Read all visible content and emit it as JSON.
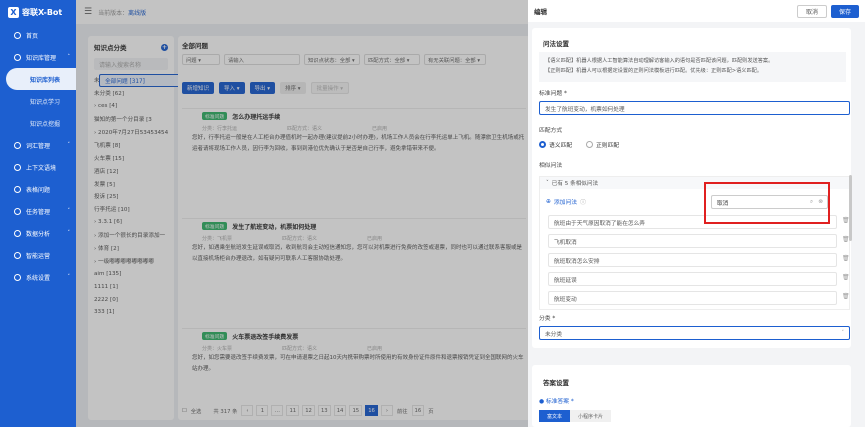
{
  "app": {
    "title": "容联X-Bot",
    "logo_letter": "X"
  },
  "topbar": {
    "version_label": "当前版本：",
    "version_value": "离线版"
  },
  "sidebar": {
    "items": [
      {
        "label": "首页",
        "icon": "home-icon",
        "chev": ""
      },
      {
        "label": "知识库管理",
        "icon": "book-icon",
        "chev": "˄"
      },
      {
        "label": "知识库列表",
        "sub": true,
        "active": true
      },
      {
        "label": "知识点学习",
        "sub": true
      },
      {
        "label": "知识点挖掘",
        "sub": true
      },
      {
        "label": "词汇管理",
        "icon": "vocab-icon",
        "chev": "˅"
      },
      {
        "label": "上下文语境",
        "icon": "context-icon",
        "chev": ""
      },
      {
        "label": "表格问题",
        "icon": "table-icon",
        "chev": ""
      },
      {
        "label": "任务管理",
        "icon": "task-icon",
        "chev": "˅"
      },
      {
        "label": "数据分析",
        "icon": "chart-icon",
        "chev": "˅"
      },
      {
        "label": "智能运营",
        "icon": "ops-icon",
        "chev": ""
      },
      {
        "label": "系统设置",
        "icon": "gear-icon",
        "chev": "˅"
      }
    ]
  },
  "kcat": {
    "title": "知识点分类",
    "search_placeholder": "请输入搜索名称",
    "tree": [
      "全部问题 [317]",
      "未审核 [24]",
      "未分类 [62]",
      "› ces [4]",
      "  猫知的第一个分目录 [3",
      "› 2020年7月27日534534543",
      "  飞机票 [8]",
      "  火车票 [15]",
      "  酒店 [12]",
      "  发票 [5]",
      "  投诉 [25]",
      "  行李托运 [10]",
      "› 3.3.1 [6]",
      "› 添加一个很长的目录添加一",
      "› 体育 [2]",
      "› 一级嘟嘟嘟嘟嘟嘟嘟嘟",
      "  aim [135]",
      "  1111 [1]",
      "  2222 [0]",
      "  333 [1]"
    ]
  },
  "main": {
    "title": "全部问题",
    "filters": [
      "问题  ▾",
      "请输入",
      "知识点状态：全部 ▾",
      "匹配方式：全部 ▾",
      "有无关联问题：全部 ▾"
    ],
    "buttons": {
      "add": "新增知识",
      "import": "导入 ▾",
      "export": "导出 ▾",
      "sort": "排序 ▾",
      "batch": "批量操作 ▾"
    },
    "cards": [
      {
        "tag": "标准问题",
        "q": "怎么办理托运手续",
        "m1": "分类：行李托运",
        "m2": "匹配方式：语义",
        "m3": "已启用",
        "ans": "您好，行李托运一般是在人工柜台办理值机时一起办理(建议提前2小时办理)，机场工作人员会在行李托运单上飞机。随漂旅卫生机场或托运者请将现场工作人员，因行李为回收，事到到港位优先确认于是否是自己行李，避免拿错带来不便。"
      },
      {
        "tag": "标准问题",
        "q": "发生了航班变动，机票如何处理",
        "m1": "分类：飞机票",
        "m2": "匹配方式：语义",
        "m3": "已启用",
        "ans": "您好，如遇乘坐航班发生延误或取消，收到航司会主动短信通知您，您可以对机票进行免费的改签或退票，同时也可以通过联系客服或是以直接机场柜台办理退改，如有疑问可联系人工客服协助处理。"
      },
      {
        "tag": "标准问题",
        "q": "火车票退改签手续费发票",
        "m1": "分类：火车票",
        "m2": "匹配方式：语义",
        "m3": "已启用",
        "ans": "您好，如您需要退改签手续费发票，可在申请退票之日起10天内携带购票时所使用的有效身份证件原件和退票报销凭证到全国联网的火车站办理。"
      }
    ],
    "pager": {
      "select_all": "全选",
      "total": "共 317 条",
      "pages": [
        "‹",
        "1",
        "…",
        "11",
        "12",
        "13",
        "14",
        "15",
        "16",
        "›"
      ],
      "current": "16",
      "goto": "前往",
      "goto_val": "16",
      "goto_unit": "页"
    }
  },
  "drawer": {
    "title": "编辑",
    "cancel": "取消",
    "save": "保存",
    "section1": "问法设置",
    "desc1": "【语义匹配】机器人根据人工智能算法自动理解访客输入的语句是否匹配该问题，匹配则发送答案。",
    "desc2": "【正则匹配】机器人可以根据定设置的正则问法模板进行匹配。优先级：正则匹配>语义匹配。",
    "std_label": "标准问题 *",
    "std_value": "发生了航班变动，机票如何处理",
    "match_label": "匹配方式",
    "match_opts": [
      "语义匹配",
      "正则匹配"
    ],
    "sim_label": "相似问法",
    "sim_head": "已有 5 条相似问法",
    "add_sim": "添加问法",
    "search_value": "取消",
    "sims": [
      "航班由于天气原因取消了能在怎么弄",
      "飞机取消",
      "航班取消怎么安排",
      "航班延误",
      "航班变动"
    ],
    "cat_label": "分类 *",
    "cat_value": "未分类",
    "section2": "答案设置",
    "ans_label": "● 标准答案 *",
    "ans_tabs": [
      "富文本",
      "小程序卡片"
    ]
  }
}
